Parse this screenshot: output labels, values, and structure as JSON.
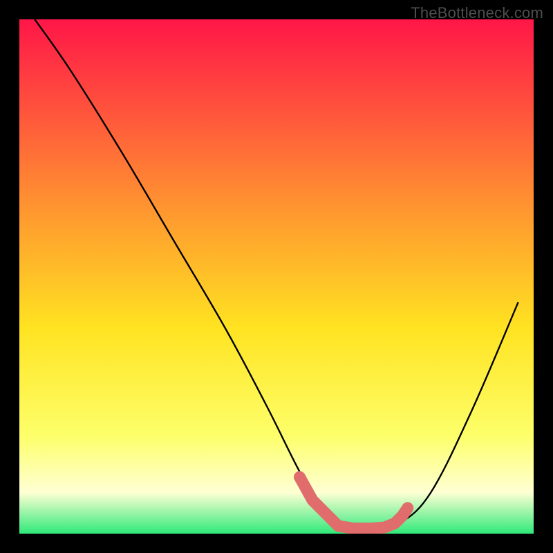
{
  "watermark": "TheBottleneck.com",
  "colors": {
    "frame": "#000000",
    "grad_top": "#ff1648",
    "grad_mid_upper": "#ff8f31",
    "grad_mid": "#ffe321",
    "grad_lower": "#fdff6a",
    "grad_cream": "#feffd3",
    "grad_green": "#2fe97a",
    "curve": "#000000",
    "marker": "#e06d6c"
  },
  "chart_data": {
    "type": "line",
    "title": "",
    "xlabel": "",
    "ylabel": "",
    "xlim": [
      0,
      100
    ],
    "ylim": [
      0,
      100
    ],
    "series": [
      {
        "name": "bottleneck-curve",
        "x": [
          3,
          10,
          20,
          30,
          40,
          48,
          54,
          58,
          62,
          66,
          70,
          74,
          80,
          88,
          97
        ],
        "y": [
          100,
          90,
          74,
          57,
          40,
          25,
          13,
          6,
          2,
          1,
          1,
          2,
          8,
          24,
          45
        ]
      }
    ],
    "markers": {
      "name": "highlight-dots",
      "x": [
        54.5,
        57,
        62,
        65,
        68,
        71,
        73,
        74.5,
        75.5
      ],
      "y": [
        11,
        6.5,
        1.5,
        1,
        1,
        1.2,
        2,
        3.5,
        5
      ]
    }
  }
}
